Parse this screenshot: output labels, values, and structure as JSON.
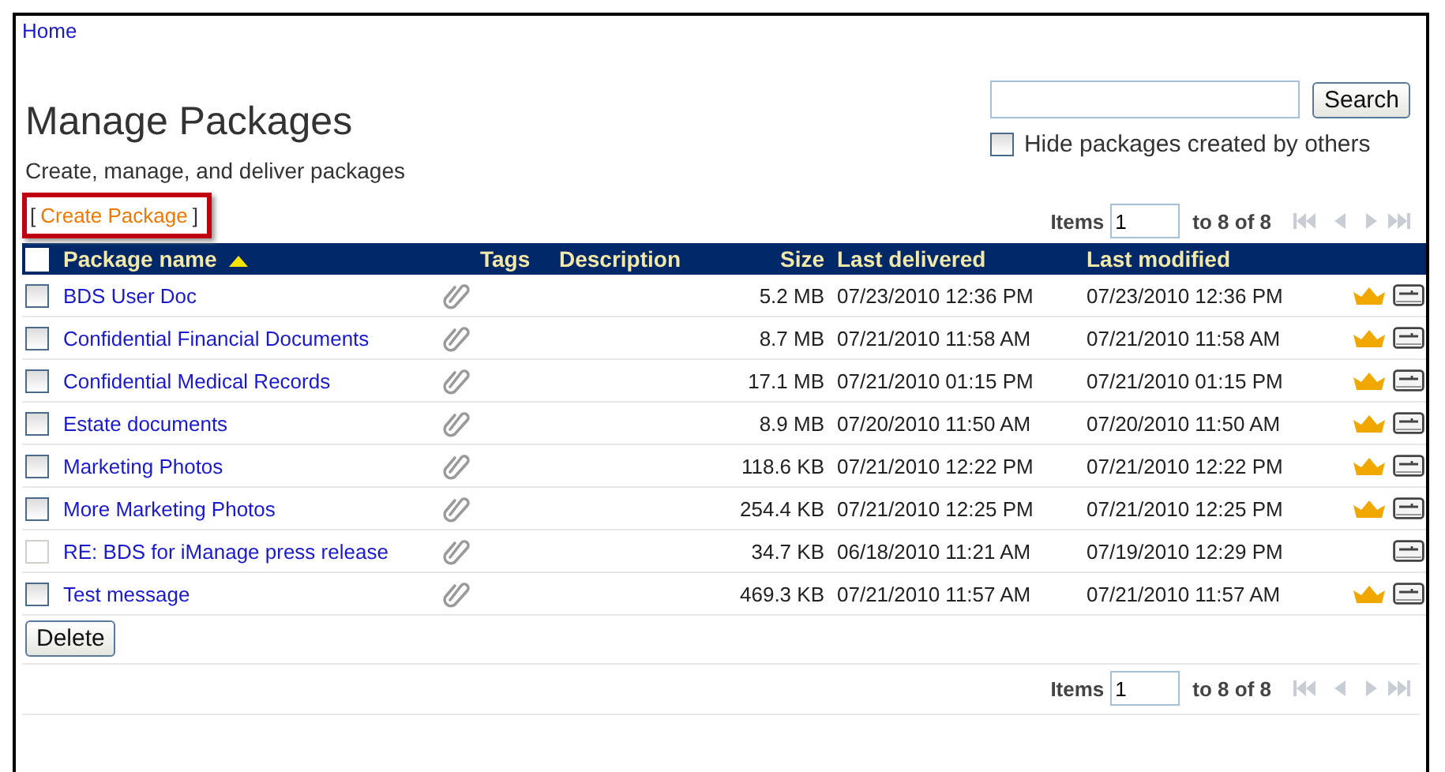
{
  "breadcrumb": "Home",
  "title": "Manage Packages",
  "subtitle": "Create, manage, and deliver packages",
  "search": {
    "button": "Search",
    "hide_label": "Hide packages created by others",
    "hide_checked": false
  },
  "create_link": {
    "open": "[",
    "label": "Create Package",
    "close": "]"
  },
  "pager_top": {
    "label": "Items",
    "value": "1",
    "range": "to 8 of 8"
  },
  "table": {
    "columns": [
      "Package name",
      "Tags",
      "Description",
      "Size",
      "Last delivered",
      "Last modified"
    ],
    "name_sorted_ascending": true,
    "select_all_checked": false,
    "rows": [
      {
        "name": "BDS User Doc",
        "size": "5.2 MB",
        "delivered": "07/23/2010 12:36 PM",
        "modified": "07/23/2010 12:36 PM",
        "checked": false,
        "disabled": false,
        "crown": true
      },
      {
        "name": "Confidential Financial Documents",
        "size": "8.7 MB",
        "delivered": "07/21/2010 11:58 AM",
        "modified": "07/21/2010 11:58 AM",
        "checked": false,
        "disabled": false,
        "crown": true
      },
      {
        "name": "Confidential Medical Records",
        "size": "17.1 MB",
        "delivered": "07/21/2010 01:15 PM",
        "modified": "07/21/2010 01:15 PM",
        "checked": false,
        "disabled": false,
        "crown": true
      },
      {
        "name": "Estate documents",
        "size": "8.9 MB",
        "delivered": "07/20/2010 11:50 AM",
        "modified": "07/20/2010 11:50 AM",
        "checked": false,
        "disabled": false,
        "crown": true
      },
      {
        "name": "Marketing Photos",
        "size": "118.6 KB",
        "delivered": "07/21/2010 12:22 PM",
        "modified": "07/21/2010 12:22 PM",
        "checked": false,
        "disabled": false,
        "crown": true
      },
      {
        "name": "More Marketing Photos",
        "size": "254.4 KB",
        "delivered": "07/21/2010 12:25 PM",
        "modified": "07/21/2010 12:25 PM",
        "checked": false,
        "disabled": false,
        "crown": true
      },
      {
        "name": "RE: BDS for iManage press release",
        "size": "34.7 KB",
        "delivered": "06/18/2010 11:21 AM",
        "modified": "07/19/2010 12:29 PM",
        "checked": false,
        "disabled": true,
        "crown": false
      },
      {
        "name": "Test message",
        "size": "469.3 KB",
        "delivered": "07/21/2010 11:57 AM",
        "modified": "07/21/2010 11:57 AM",
        "checked": false,
        "disabled": false,
        "crown": true
      }
    ]
  },
  "delete_button": "Delete",
  "pager_bottom": {
    "label": "Items",
    "value": "1",
    "range": "to 8 of 8"
  }
}
